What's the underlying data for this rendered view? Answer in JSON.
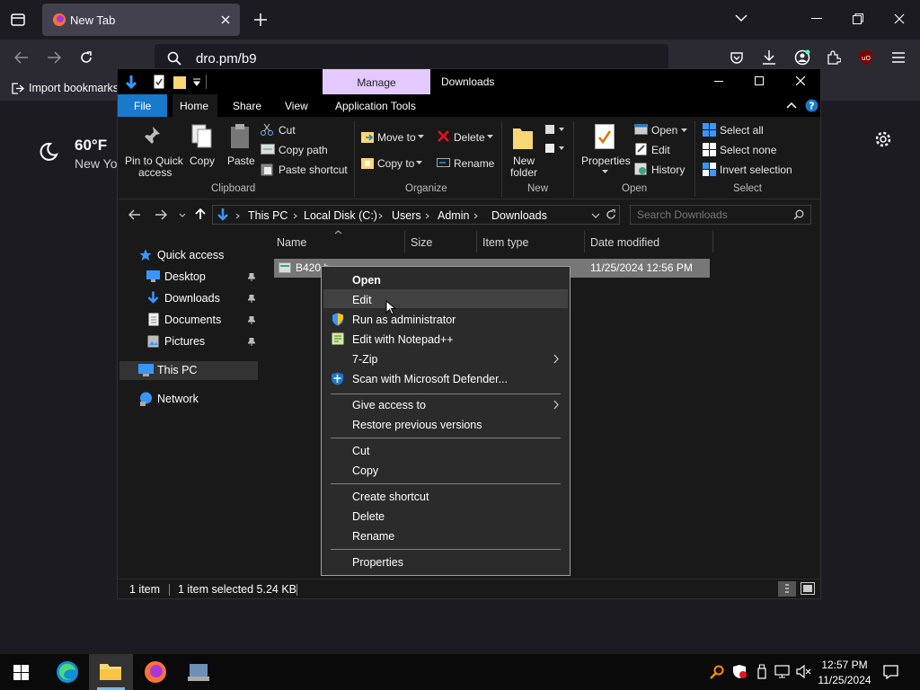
{
  "browser": {
    "tab_title": "New Tab",
    "url": "dro.pm/b9",
    "bookmark_import": "Import bookmarks",
    "weather": {
      "temp": "60°F",
      "location": "New Yo"
    }
  },
  "explorer": {
    "context_tab": "Manage",
    "window_title": "Downloads",
    "ribbon_tabs": [
      "File",
      "Home",
      "Share",
      "View",
      "Application Tools"
    ],
    "clipboard": {
      "pin": "Pin to Quick",
      "pin2": "access",
      "copy": "Copy",
      "paste": "Paste",
      "cut": "Cut",
      "copy_path": "Copy path",
      "paste_shortcut": "Paste shortcut",
      "group": "Clipboard"
    },
    "organize": {
      "move_to": "Move to",
      "copy_to": "Copy to",
      "delete": "Delete",
      "rename": "Rename",
      "group": "Organize"
    },
    "new": {
      "new_folder": "New",
      "new_folder2": "folder",
      "group": "New"
    },
    "open": {
      "properties": "Properties",
      "open": "Open",
      "edit": "Edit",
      "history": "History",
      "group": "Open"
    },
    "select": {
      "select_all": "Select all",
      "select_none": "Select none",
      "invert": "Invert selection",
      "group": "Select"
    },
    "breadcrumb": [
      "This PC",
      "Local Disk (C:)",
      "Users",
      "Admin",
      "Downloads"
    ],
    "search_placeholder": "Search Downloads",
    "nav": {
      "quick_access": "Quick access",
      "desktop": "Desktop",
      "downloads": "Downloads",
      "documents": "Documents",
      "pictures": "Pictures",
      "this_pc": "This PC",
      "network": "Network"
    },
    "columns": [
      "Name",
      "Size",
      "Item type",
      "Date modified"
    ],
    "file": {
      "name": "B420.b",
      "date": "11/25/2024 12:56 PM"
    },
    "status": {
      "count": "1 item",
      "selected": "1 item selected  5.24 KB"
    }
  },
  "context_menu": {
    "open": "Open",
    "edit": "Edit",
    "run_admin": "Run as administrator",
    "notepad": "Edit with Notepad++",
    "zip": "7-Zip",
    "defender": "Scan with Microsoft Defender...",
    "give_access": "Give access to",
    "restore": "Restore previous versions",
    "cut": "Cut",
    "copy": "Copy",
    "create_shortcut": "Create shortcut",
    "delete": "Delete",
    "rename": "Rename",
    "properties": "Properties"
  },
  "taskbar": {
    "time": "12:57 PM",
    "date": "11/25/2024"
  }
}
